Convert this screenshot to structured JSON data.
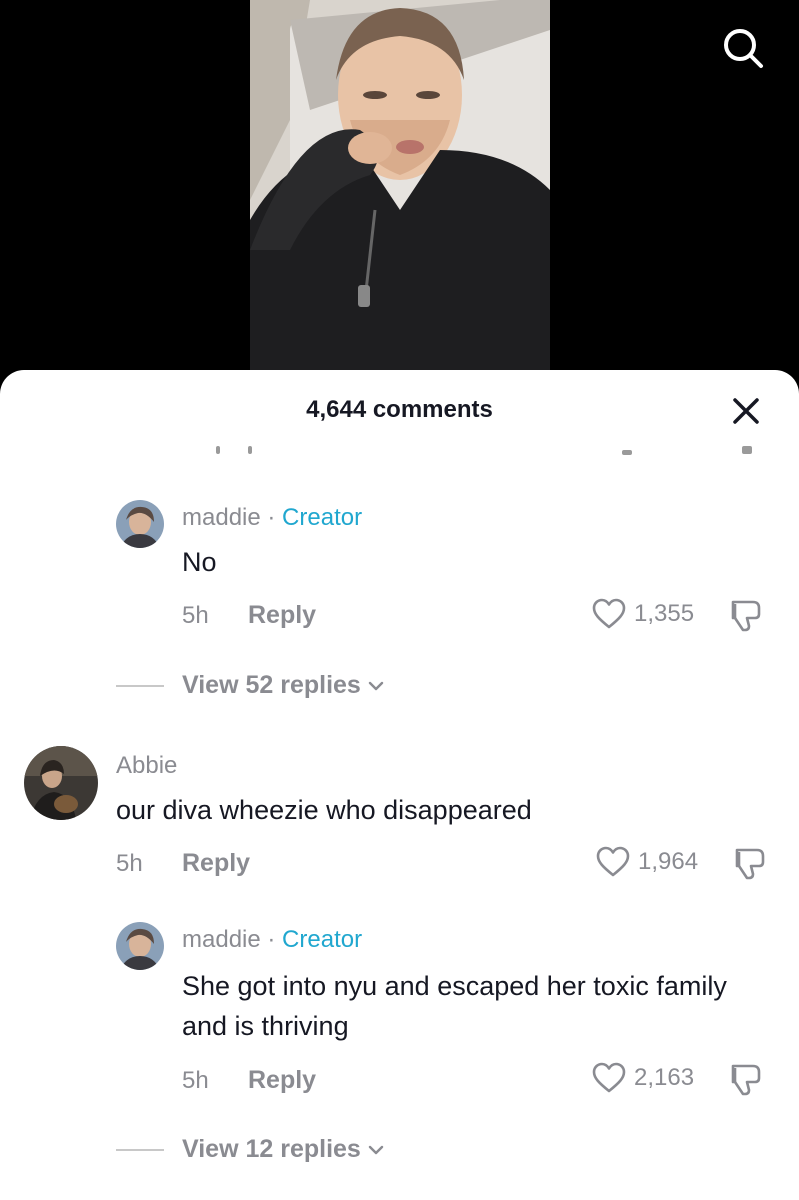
{
  "header": {
    "comments_count": "4,644 comments"
  },
  "icons": {
    "search": "search-icon",
    "close": "close-icon",
    "like": "heart-icon",
    "dislike": "thumbs-down-icon",
    "chevron": "chevron-down-icon"
  },
  "colors": {
    "creator_tag": "#20a7cf",
    "secondary_text": "#8a8b91",
    "primary_text": "#161823"
  },
  "comments": [
    {
      "author": "maddie",
      "separator": " · ",
      "badge": "Creator",
      "text": "No",
      "time": "5h",
      "reply_label": "Reply",
      "likes": "1,355",
      "view_replies": "View 52 replies"
    },
    {
      "author": "Abbie",
      "text": "our diva wheezie who disappeared",
      "time": "5h",
      "reply_label": "Reply",
      "likes": "1,964"
    },
    {
      "author": "maddie",
      "separator": " · ",
      "badge": "Creator",
      "text": "She got into nyu and escaped her toxic family and is thriving",
      "time": "5h",
      "reply_label": "Reply",
      "likes": "2,163",
      "view_replies": "View 12 replies"
    }
  ]
}
